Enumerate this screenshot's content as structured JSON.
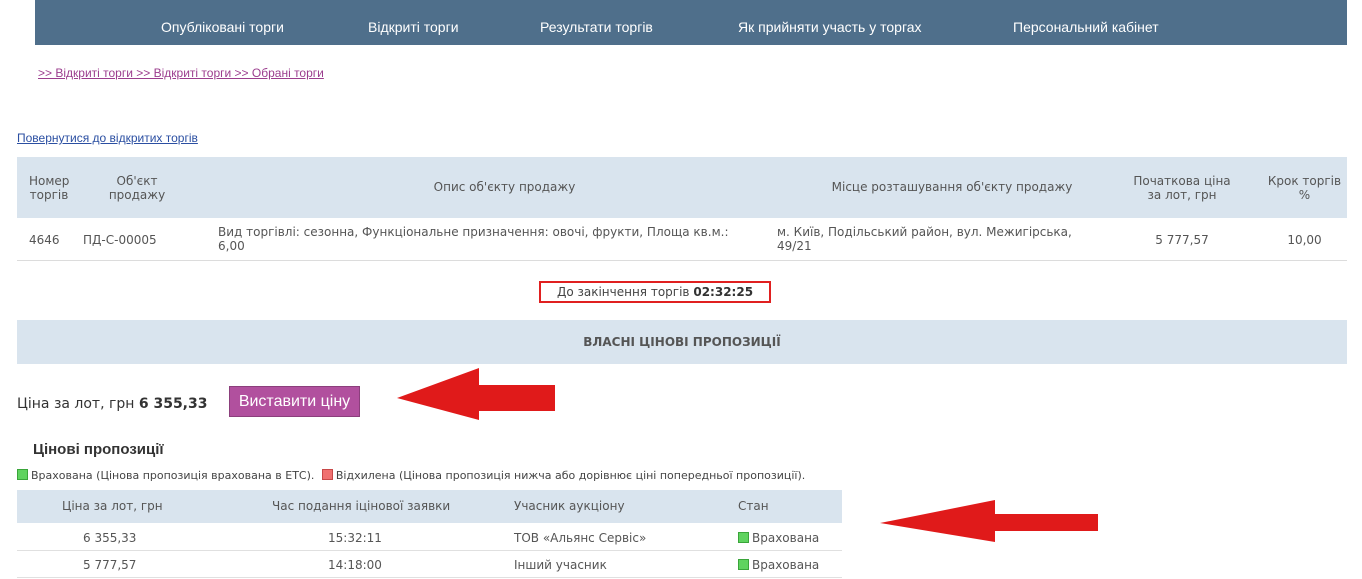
{
  "nav": {
    "items": [
      {
        "label": "Опубліковані торги"
      },
      {
        "label": "Відкриті торги"
      },
      {
        "label": "Результати торгів"
      },
      {
        "label": "Як прийняти участь у торгах"
      },
      {
        "label": "Персональний кабінет"
      }
    ]
  },
  "breadcrumb": ">> Відкриті торги >> Відкриті торги >> Обрані торги",
  "back_link": "Повернутися до відкритих торгів",
  "lot_table": {
    "headers": {
      "number": [
        "Номер",
        "торгів"
      ],
      "object": [
        "Об'єкт",
        "продажу"
      ],
      "description": "Опис об'єкту продажу",
      "location": "Місце розташування об'єкту продажу",
      "start_price": [
        "Початкова ціна",
        "за лот, грн"
      ],
      "step": [
        "Крок торгів",
        "%"
      ]
    },
    "row": {
      "number": "4646",
      "object": "ПД-С-00005",
      "description": [
        "Вид торгівлі: сезонна, Функціональне призначення: овочі, фрукти, Площа кв.м.:",
        "6,00"
      ],
      "location": [
        "м. Київ, Подільський район, вул. Межигірська,",
        "49/21"
      ],
      "start_price": "5 777,57",
      "step": "10,00"
    }
  },
  "timer": {
    "label": "До закінчення торгів",
    "value": "02:32:25"
  },
  "section_title": "ВЛАСНІ ЦІНОВІ ПРОПОЗИЦІЇ",
  "price": {
    "label": "Ціна за лот, грн",
    "value": "6 355,33",
    "button": "Виставити ціну"
  },
  "proposals": {
    "title": "Цінові пропозиції",
    "legend": {
      "accepted": "Врахована (Цінова пропозиція врахована в ЕТС).",
      "rejected": "Відхилена (Цінова пропозиція нижча або дорівнює ціні попередньої пропозиції)."
    },
    "headers": {
      "price": "Ціна за лот, грн",
      "time": "Час подання іцінової заявки",
      "participant": "Учасник аукціону",
      "status": "Стан"
    },
    "rows": [
      {
        "price": "6 355,33",
        "time": "15:32:11",
        "participant": "ТОВ «Альянс Сервіс»",
        "status": "Врахована"
      },
      {
        "price": "5 777,57",
        "time": "14:18:00",
        "participant": "Інший учасник",
        "status": "Врахована"
      }
    ]
  },
  "colors": {
    "nav_bg": "#4f6f8b",
    "header_bg": "#d9e4ee",
    "button_bg": "#b1509e",
    "accepted": "#5fd35f",
    "rejected": "#f07070",
    "arrow": "#e01a1a"
  }
}
